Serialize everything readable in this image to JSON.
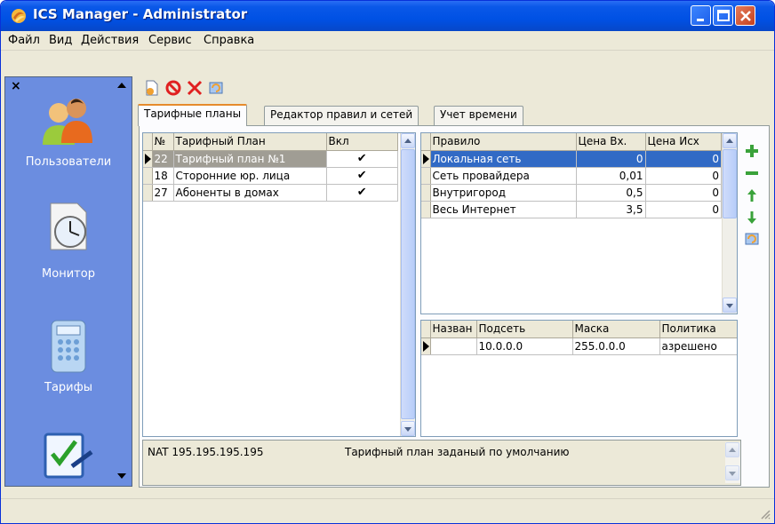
{
  "window": {
    "title": "ICS Manager - Administrator"
  },
  "menu": {
    "items": [
      "Файл",
      "Вид",
      "Действия",
      "Сервис",
      "Справка"
    ]
  },
  "sidebar": {
    "close": "×",
    "items": [
      {
        "label": "Пользователи",
        "icon": "users-icon"
      },
      {
        "label": "Монитор",
        "icon": "monitor-clock-icon"
      },
      {
        "label": "Тарифы",
        "icon": "calculator-icon"
      },
      {
        "label": "",
        "icon": "checklist-icon"
      }
    ]
  },
  "toolbar": {
    "icons": [
      "new-document-icon",
      "stop-icon",
      "delete-icon",
      "refresh-icon"
    ]
  },
  "tabs": [
    "Тарифные планы",
    "Редактор правил и сетей",
    "Учет времени"
  ],
  "plans_table": {
    "headers": [
      "№",
      "Тарифный План",
      "Вкл"
    ],
    "rows": [
      {
        "num": "22",
        "name": "Тарифный план №1",
        "enabled": "✔",
        "selected": true
      },
      {
        "num": "18",
        "name": "Сторонние юр. лица",
        "enabled": "✔",
        "selected": false
      },
      {
        "num": "27",
        "name": "Абоненты в домах",
        "enabled": "✔",
        "selected": false
      }
    ]
  },
  "rules_table": {
    "headers": [
      "Правило",
      "Цена Вх.",
      "Цена Исх"
    ],
    "rows": [
      {
        "rule": "Локальная сеть",
        "price_in": "0",
        "price_out": "0",
        "selected": true
      },
      {
        "rule": "Сеть провайдера",
        "price_in": "0,01",
        "price_out": "0",
        "selected": false
      },
      {
        "rule": "Внутригород",
        "price_in": "0,5",
        "price_out": "0",
        "selected": false
      },
      {
        "rule": "Весь Интернет",
        "price_in": "3,5",
        "price_out": "0",
        "selected": false
      }
    ]
  },
  "subnet_table": {
    "headers": [
      "Назван",
      "Подсеть",
      "Маска",
      "Политика"
    ],
    "rows": [
      {
        "name": "",
        "subnet": "10.0.0.0",
        "mask": "255.0.0.0",
        "policy": "азрешено"
      }
    ]
  },
  "side_tools": [
    "add-icon",
    "remove-icon",
    "move-up-icon",
    "move-down-icon",
    "refresh-icon"
  ],
  "info": {
    "nat": "NAT  195.195.195.195",
    "description": "Тарифный план заданый по умолчанию"
  }
}
